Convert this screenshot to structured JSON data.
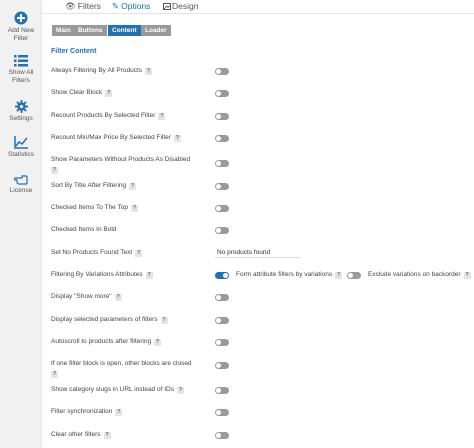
{
  "sidebar": {
    "items": [
      {
        "label": "Add New Filter",
        "line1": "Add New",
        "line2": "Filter",
        "icon": "plus-circle-icon"
      },
      {
        "label": "Show All Filters",
        "line1": "Show All",
        "line2": "Filters",
        "icon": "list-icon"
      },
      {
        "label": "Settings",
        "line1": "Settings",
        "icon": "gear-icon"
      },
      {
        "label": "Statistics",
        "line1": "Statistics",
        "icon": "chart-icon"
      },
      {
        "label": "License",
        "line1": "License",
        "icon": "hand-pointer-icon"
      }
    ]
  },
  "top_tabs": [
    {
      "label": "Filters",
      "icon": "eye-icon",
      "active": false
    },
    {
      "label": "Options",
      "icon": "wrench-icon",
      "active": true
    },
    {
      "label": "Design",
      "icon": "image-icon",
      "active": false
    }
  ],
  "subtabs": [
    {
      "label": "Main",
      "active": false
    },
    {
      "label": "Buttons",
      "active": false
    },
    {
      "label": "Content",
      "active": true
    },
    {
      "label": "Loader",
      "active": false
    }
  ],
  "section_title": "Filter Content",
  "help_glyph": "?",
  "options": [
    {
      "label": "Always Filtering By All Products",
      "help": true,
      "on": false
    },
    {
      "label": "Show Clear Block",
      "help": true,
      "on": false
    },
    {
      "label": "Recount Products By Selected Filter",
      "help": true,
      "on": false
    },
    {
      "label": "Recount Min/Max Price By Selected Filter",
      "help": true,
      "on": false
    },
    {
      "label": "Show Parameters Without Products As Disabled",
      "help": true,
      "on": false
    },
    {
      "label": "Sort By Title After Filtering",
      "help": true,
      "on": false
    },
    {
      "label": "Checked Items To The Top",
      "help": true,
      "on": false
    },
    {
      "label": "Checked Items In Bold",
      "help": false,
      "on": false
    },
    {
      "label": "Set No Products Found Text",
      "help": true,
      "input_value": "No products found"
    },
    {
      "label": "Filtering By Variations Attributes",
      "help": true,
      "on": true
    },
    {
      "label": "Display \"Show more\"",
      "help": true,
      "on": false
    },
    {
      "label": "Display selected parameters of filters",
      "help": true,
      "on": false
    },
    {
      "label": "Autoscroll to products after filtering",
      "help": true,
      "on": false
    },
    {
      "label": "If one filter block is open, other blocks are closed",
      "help": true,
      "on": false
    },
    {
      "label": "Show category slugs in URL instead of IDs",
      "help": true,
      "on": false
    },
    {
      "label": "Filter synchronization",
      "help": true,
      "on": false
    },
    {
      "label": "Clear other filters",
      "help": true,
      "on": false
    }
  ],
  "variations": {
    "form_attribute_label": "Form attribute filters by variations",
    "exclude_label": "Exclude variations on backorder",
    "exclude_on": false
  },
  "colors": {
    "accent": "#2271b1",
    "toggle_off": "#9a9a9a",
    "subtab_inactive": "#999999"
  }
}
